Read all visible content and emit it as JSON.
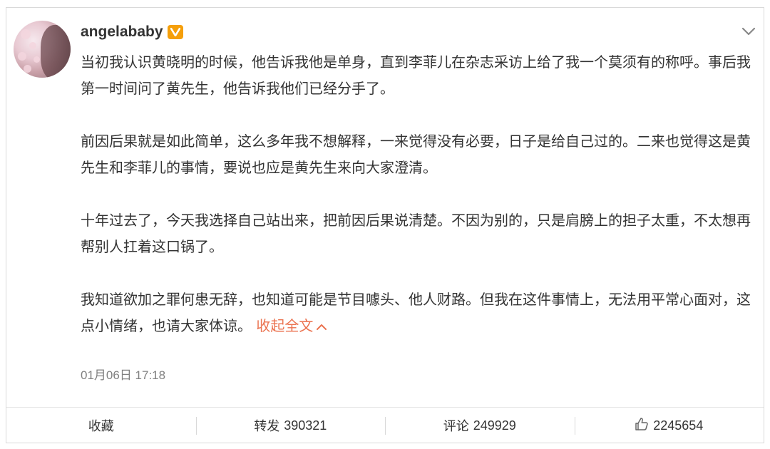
{
  "post": {
    "username": "angelababy",
    "verified_icon": "verified-badge-icon",
    "paragraphs": [
      "当初我认识黄晓明的时候，他告诉我他是单身，直到李菲儿在杂志采访上给了我一个莫须有的称呼。事后我第一时间问了黄先生，他告诉我他们已经分手了。",
      "前因后果就是如此简单，这么多年我不想解释，一来觉得没有必要，日子是给自己过的。二来也觉得这是黄先生和李菲儿的事情，要说也应是黄先生来向大家澄清。",
      "十年过去了，今天我选择自己站出来，把前因后果说清楚。不因为别的，只是肩膀上的担子太重，不太想再帮别人扛着这口锅了。",
      "我知道欲加之罪何患无辞，也知道可能是节目噱头、他人财路。但我在这件事情上，无法用平常心面对，这点小情绪，也请大家体谅。"
    ],
    "collapse_label": "收起全文",
    "timestamp": "01月06日 17:18"
  },
  "actions": {
    "favorite_label": "收藏",
    "repost_label": "转发",
    "repost_count": "390321",
    "comment_label": "评论",
    "comment_count": "249929",
    "like_count": "2245654"
  },
  "colors": {
    "link": "#eb7350",
    "verified": "#f59f0a",
    "meta": "#808080"
  }
}
